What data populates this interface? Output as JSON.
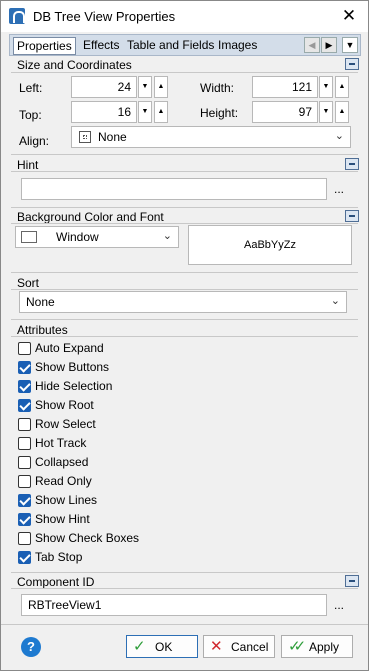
{
  "window": {
    "title": "DB Tree View Properties",
    "close_glyph": "✕"
  },
  "tabs": [
    "Properties",
    "Effects",
    "Table and Fields",
    "Images"
  ],
  "size_coords": {
    "title": "Size and Coordinates",
    "left_label": "Left:",
    "left_value": "24",
    "top_label": "Top:",
    "top_value": "16",
    "width_label": "Width:",
    "width_value": "121",
    "height_label": "Height:",
    "height_value": "97",
    "align_label": "Align:",
    "align_value": "None"
  },
  "hint": {
    "title": "Hint",
    "value": ""
  },
  "bg_font": {
    "title": "Background Color and Font",
    "color_value": "Window",
    "font_preview": "AaBbYyZz"
  },
  "sort": {
    "title": "Sort",
    "value": "None"
  },
  "attributes": {
    "title": "Attributes",
    "items": [
      {
        "label": "Auto Expand",
        "checked": false
      },
      {
        "label": "Show Buttons",
        "checked": true
      },
      {
        "label": "Hide Selection",
        "checked": true
      },
      {
        "label": "Show Root",
        "checked": true
      },
      {
        "label": "Row Select",
        "checked": false
      },
      {
        "label": "Hot Track",
        "checked": false
      },
      {
        "label": "Collapsed",
        "checked": false
      },
      {
        "label": "Read Only",
        "checked": false
      },
      {
        "label": "Show Lines",
        "checked": true
      },
      {
        "label": "Show Hint",
        "checked": true
      },
      {
        "label": "Show Check Boxes",
        "checked": false
      },
      {
        "label": "Tab Stop",
        "checked": true
      }
    ]
  },
  "component_id": {
    "title": "Component ID",
    "value": "RBTreeView1"
  },
  "footer": {
    "ok_label": "OK",
    "cancel_label": "Cancel",
    "apply_label": "Apply",
    "help_glyph": "?"
  },
  "icons": {
    "ok": "check-icon",
    "cancel": "x-icon",
    "apply": "double-check-icon"
  },
  "colors": {
    "accent": "#1a5fb4",
    "ok_check": "#2e9e3a",
    "cancel_x": "#d0282e"
  }
}
